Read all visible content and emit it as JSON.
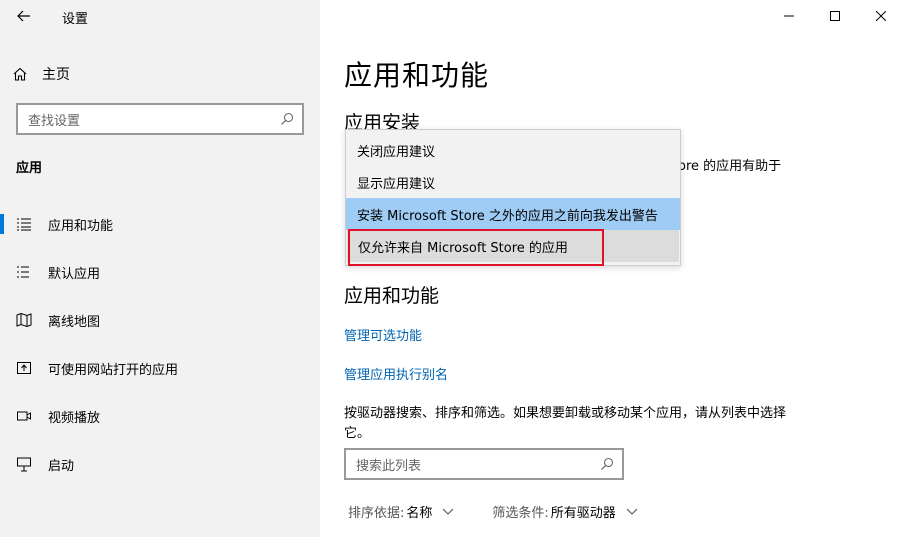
{
  "window": {
    "app_title": "设置",
    "minimize_icon": "minimize-icon",
    "maximize_icon": "maximize-icon",
    "close_icon": "close-icon"
  },
  "sidebar": {
    "home_label": "主页",
    "search_placeholder": "查找设置",
    "section_title": "应用",
    "items": [
      {
        "label": "应用和功能",
        "icon": "list-icon",
        "active": true
      },
      {
        "label": "默认应用",
        "icon": "list-icon",
        "active": false
      },
      {
        "label": "离线地图",
        "icon": "map-icon",
        "active": false
      },
      {
        "label": "可使用网站打开的应用",
        "icon": "web-app-icon",
        "active": false
      },
      {
        "label": "视频播放",
        "icon": "video-icon",
        "active": false
      },
      {
        "label": "启动",
        "icon": "startup-icon",
        "active": false
      }
    ]
  },
  "main": {
    "page_title": "应用和功能",
    "install_section_title": "应用安装",
    "install_partial_text": "ore 的应用有助于",
    "features_section_title": "应用和功能",
    "link_optional_features": "管理可选功能",
    "link_exec_alias": "管理应用执行别名",
    "description": "按驱动器搜索、排序和筛选。如果想要卸载或移动某个应用，请从列表中选择它。",
    "list_search_placeholder": "搜索此列表",
    "sort_label": "排序依据:",
    "sort_value": "名称",
    "filter_label": "筛选条件:",
    "filter_value": "所有驱动器"
  },
  "dropdown": {
    "options": [
      "关闭应用建议",
      "显示应用建议",
      "安装 Microsoft Store 之外的应用之前向我发出警告",
      "仅允许来自 Microsoft Store 的应用"
    ],
    "hovered_index": 2,
    "selected_index": 3
  },
  "colors": {
    "accent": "#0078d7",
    "link": "#0063b1",
    "highlight_border": "#e0102a",
    "hover_bg": "#9fccf4"
  }
}
